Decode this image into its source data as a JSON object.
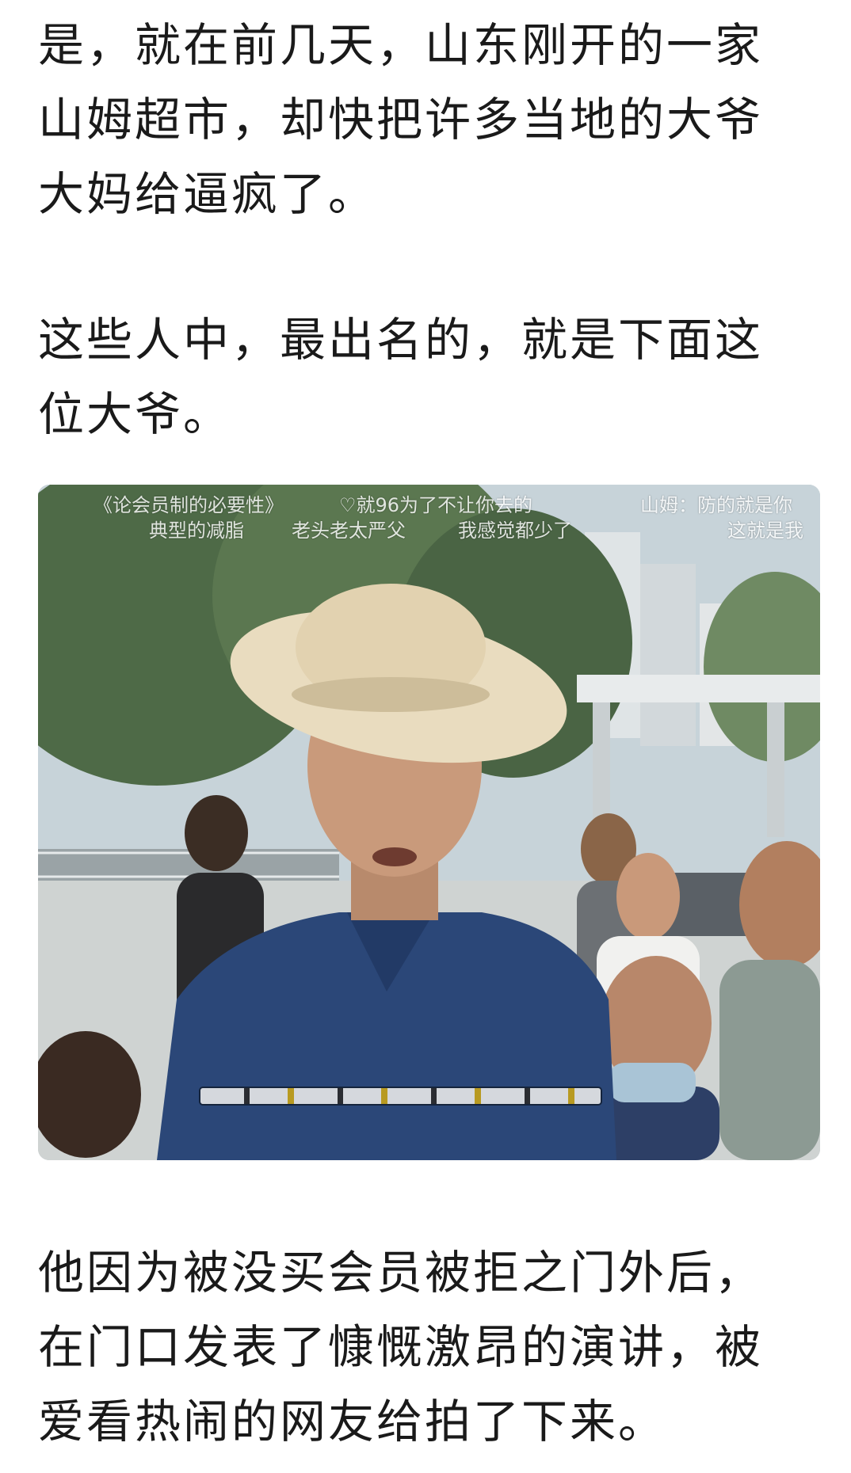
{
  "paragraphs": {
    "p1": "是，就在前几天，山东刚开的一家山姆超市，却快把许多当地的大爷大妈给逼疯了。",
    "p2": "这些人中，最出名的，就是下面这位大爷。",
    "p3": "他因为被没买会员被拒之门外后，在门口发表了慷慨激昂的演讲，被爱看热闹的网友给拍了下来。"
  },
  "video": {
    "danmaku": {
      "d1": "《论会员制的必要性》",
      "d2": "♡就96为了不让你去的",
      "d3": "山姆：防的就是你",
      "d4": "典型的减脂",
      "d5": "老头老太严父",
      "d6": "我感觉都少了",
      "d7": "这就是我"
    }
  }
}
